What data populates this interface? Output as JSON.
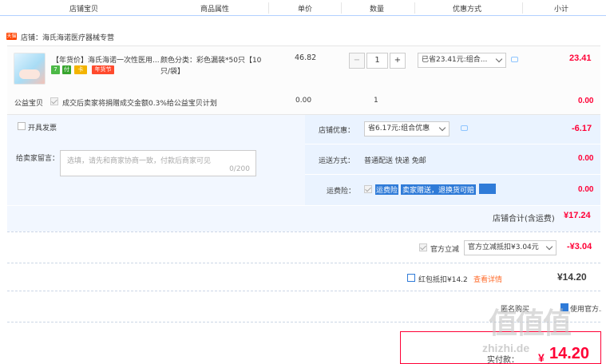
{
  "columns": [
    "店铺宝贝",
    "商品属性",
    "单价",
    "数量",
    "优惠方式",
    "小计"
  ],
  "shop": {
    "icon": "天猫",
    "label": "店铺：海氏海诺医疗器械专营"
  },
  "item": {
    "title_line1": "【年货价】海氏海诺一次性医用...",
    "badges": [
      "7",
      "付",
      "卡",
      "年货节"
    ],
    "attr_line1": "颜色分类：彩色漏装*50只【10",
    "attr_line2": "只/袋】",
    "price": "46.82",
    "qty": "1",
    "qty_minus": "−",
    "qty_plus": "+",
    "promo": "已省23.41元:组合...",
    "subtotal": "23.41"
  },
  "charity": {
    "label": "公益宝贝",
    "text": "成交后卖家将捐赠成交金额0.3%给公益宝贝计划",
    "price": "0.00",
    "qty": "1",
    "subtotal": "0.00"
  },
  "invoice": {
    "label": "开具发票"
  },
  "memo": {
    "label": "给卖家留言：",
    "placeholder": "选填，请先和商家协商一致，付款后商家可见",
    "count": "0/200"
  },
  "shop_discount": {
    "label": "店铺优惠：",
    "value": "省6.17元:组合优惠",
    "amount": "-6.17"
  },
  "shipping": {
    "label": "运送方式：",
    "value": "普通配送 快递 免邮",
    "amount": "0.00"
  },
  "insurance": {
    "label": "运费险：",
    "seg1": "运费险",
    "seg2": "卖家赠送，退换货可赔",
    "amount": "0.00"
  },
  "shop_total": {
    "label": "店铺合计(含运费)",
    "amount": "¥17.24"
  },
  "official": {
    "label": "官方立减",
    "value": "官方立减抵扣¥3.04元",
    "amount": "-¥3.04"
  },
  "redpacket": {
    "label": "红包抵扣¥14.2",
    "link": "查看详情",
    "amount": "¥14.20"
  },
  "bottom": {
    "anon": "匿名购买",
    "agree": "使用官方..."
  },
  "pay": {
    "label": "实付款：",
    "currency": "¥",
    "amount": "14.20"
  },
  "watermark": {
    "text": "值值值",
    "url": "zhizhi.de"
  }
}
